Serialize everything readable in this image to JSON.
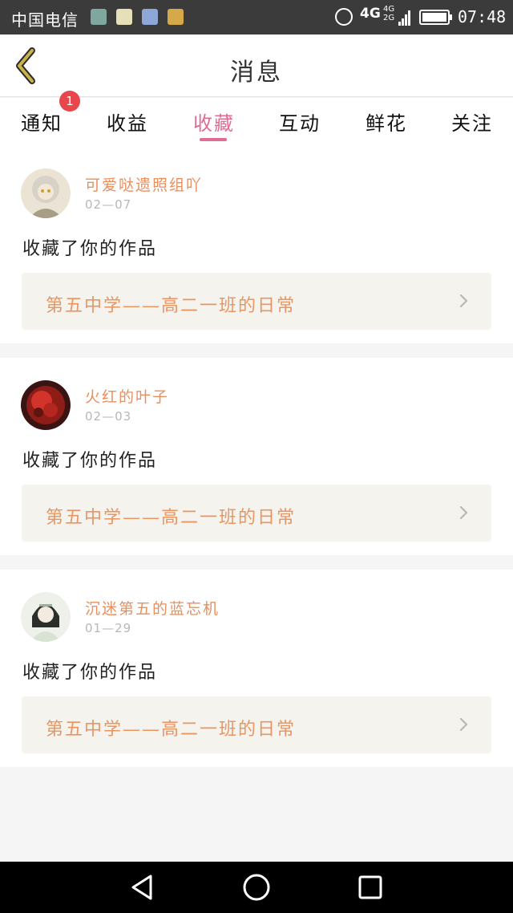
{
  "status_bar": {
    "carrier": "中国电信",
    "network": "4G",
    "network_small_top": "4G",
    "network_small_bottom": "2G",
    "time": "07:48",
    "icons": [
      "app-notification-icon",
      "chat-notification-icon",
      "baidu-notification-icon",
      "wifi-hotspot-icon",
      "alarm-icon",
      "signal-icon",
      "battery-icon"
    ]
  },
  "header": {
    "title": "消息",
    "back_icon": "chevron-left-icon"
  },
  "tabs": {
    "items": [
      {
        "label": "通知"
      },
      {
        "label": "收益"
      },
      {
        "label": "收藏"
      },
      {
        "label": "互动"
      },
      {
        "label": "鲜花"
      },
      {
        "label": "关注"
      }
    ],
    "active": "收藏",
    "notification_badge": "1"
  },
  "messages": [
    {
      "user": "可爱哒遗照组吖",
      "date": "02—07",
      "action": "收藏了你的作品",
      "work_title": "第五中学——高二一班的日常"
    },
    {
      "user": "火红的叶子",
      "date": "02—03",
      "action": "收藏了你的作品",
      "work_title": "第五中学——高二一班的日常"
    },
    {
      "user": "沉迷第五的蓝忘机",
      "date": "01—29",
      "action": "收藏了你的作品",
      "work_title": "第五中学——高二一班的日常"
    }
  ],
  "bottom_nav": {
    "icons": [
      "back-triangle-icon",
      "home-circle-icon",
      "recents-square-icon"
    ]
  },
  "colors": {
    "accent_pink": "#e06b93",
    "username_orange": "#e88f5e",
    "work_title_orange": "#ea9561",
    "badge_red": "#e8454c",
    "work_box_bg": "#f4f3ee",
    "back_icon_olive": "#c9b24a"
  }
}
